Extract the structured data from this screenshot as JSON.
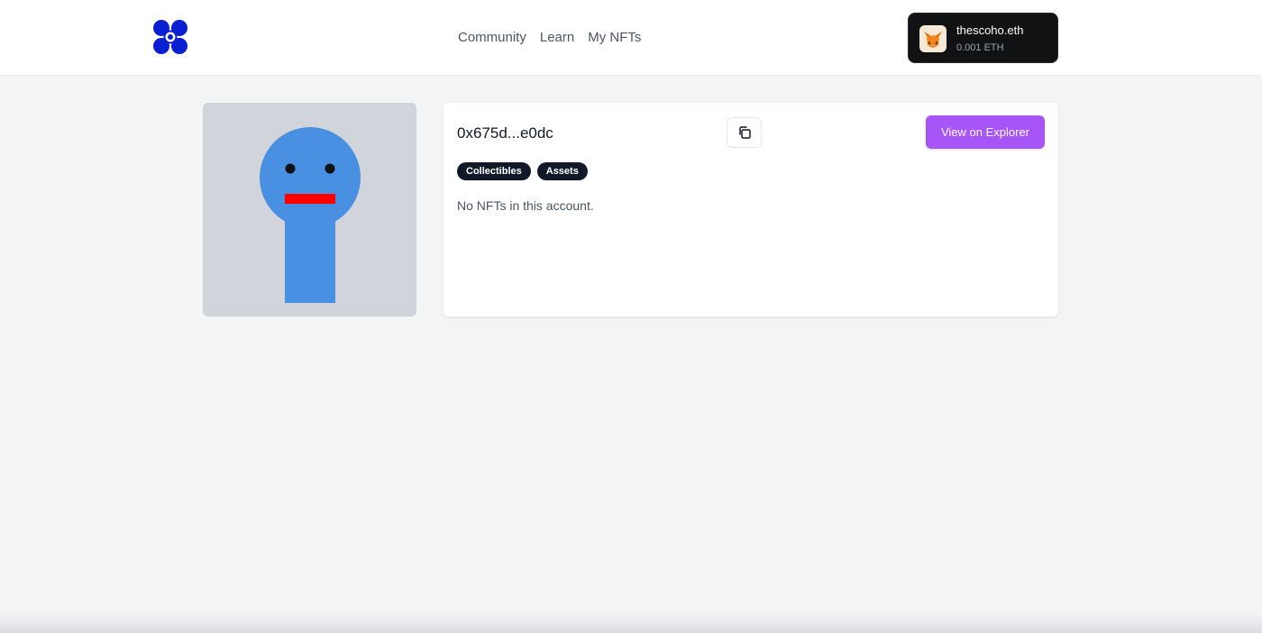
{
  "header": {
    "logo_icon": "flower-logo-icon",
    "brand_color": "#0a1fd1",
    "nav": [
      {
        "label": "Community"
      },
      {
        "label": "Learn"
      },
      {
        "label": "My NFTs"
      }
    ],
    "wallet": {
      "icon": "metamask-fox-icon",
      "name": "thescoho.eth",
      "balance": "0.001 ETH"
    }
  },
  "profile": {
    "avatar_icon": "blue-figure-avatar",
    "avatar_color": "#4a90e2",
    "address": "0x675d...e0dc",
    "copy_icon": "copy-icon",
    "explorer_label": "View on Explorer",
    "explorer_color": "#a855f7",
    "tags": [
      {
        "label": "Collectibles"
      },
      {
        "label": "Assets"
      }
    ],
    "empty_message": "No NFTs in this account."
  }
}
